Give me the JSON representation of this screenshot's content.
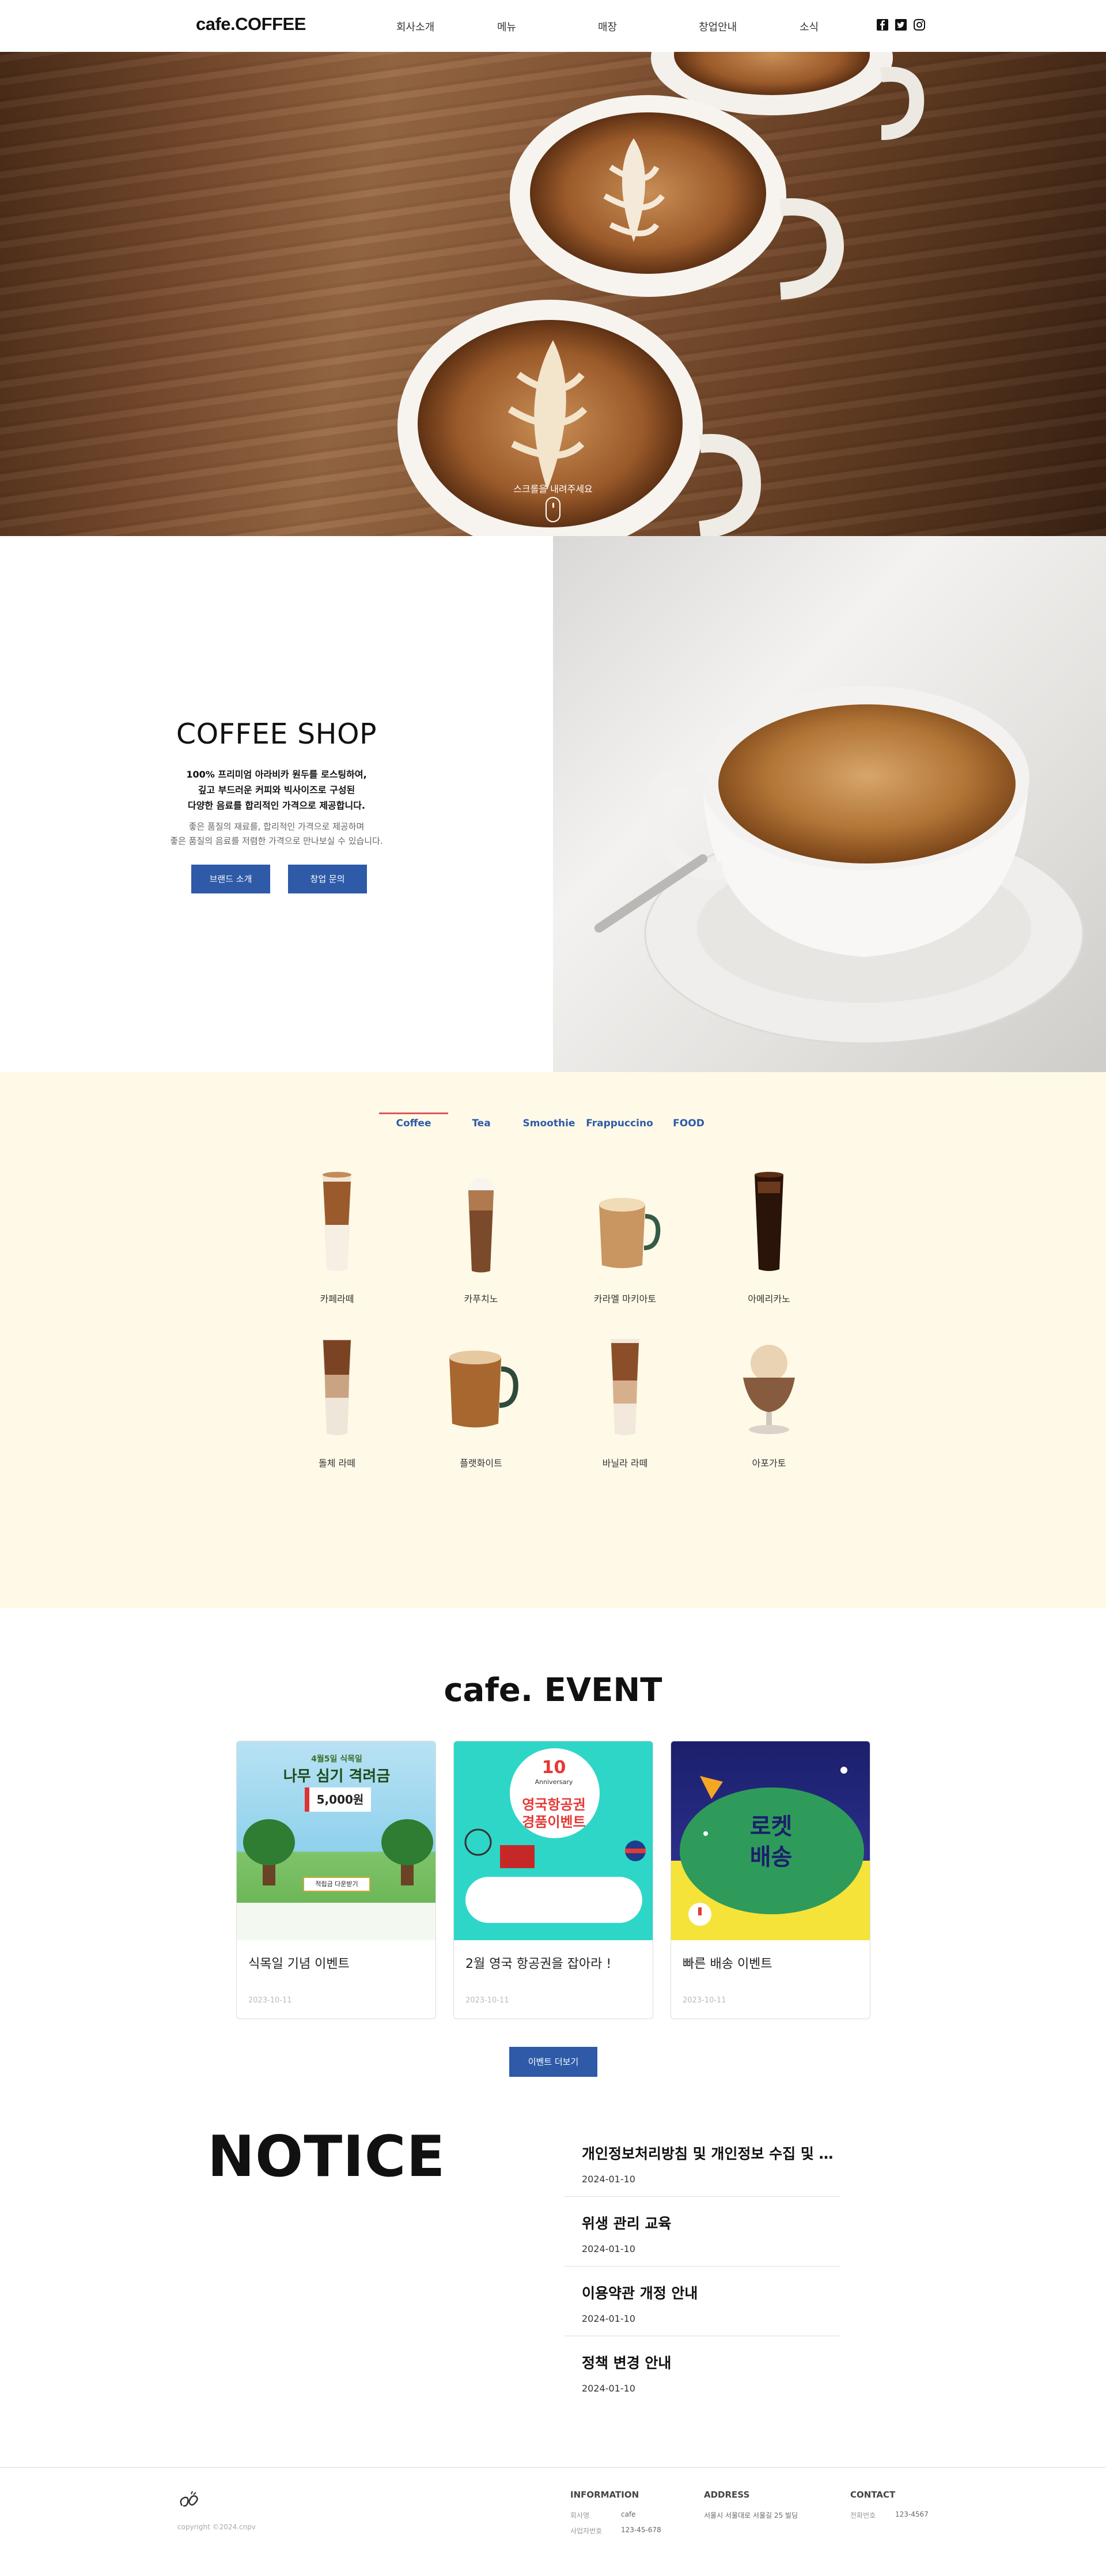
{
  "header": {
    "logo": "cafe.COFFEE",
    "nav": [
      "회사소개",
      "메뉴",
      "매장",
      "창업안내",
      "소식"
    ],
    "social_icons": [
      "facebook-icon",
      "twitter-icon",
      "instagram-icon"
    ]
  },
  "hero": {
    "scroll_hint": "스크롤을 내려주세요"
  },
  "intro": {
    "title": "COFFEE SHOP",
    "bold_lines": [
      "100% 프리미엄 아라비카 원두를 로스팅하여,",
      "깊고 부드러운 커피와 빅사이즈로 구성된",
      "다양한 음료를 합리적인 가격으로 제공합니다."
    ],
    "sub_lines": [
      "좋은 품질의 재료를, 합리적인 가격으로 제공하며",
      "좋은 품질의 음료를 저렴한 가격으로 만나보실 수 있습니다."
    ],
    "buttons": [
      "브랜드 소개",
      "창업 문의"
    ]
  },
  "menu": {
    "tabs": [
      "Coffee",
      "Tea",
      "Smoothie",
      "Frappuccino",
      "FOOD"
    ],
    "active_tab": "Coffee",
    "products": [
      "카페라떼",
      "카푸치노",
      "카라멜 마키아토",
      "아메리카노",
      "돌체 라떼",
      "플랫화이트",
      "바닐라 라떼",
      "아포가토"
    ]
  },
  "events": {
    "title": "cafe. EVENT",
    "cards": [
      {
        "title": "식목일 기념 이벤트",
        "date": "2023-10-11",
        "poster": {
          "kicker": "4월5일 식목일",
          "headline": "나무 심기 격려금",
          "amount": "5,000원",
          "cta": "적립금 다운받기"
        }
      },
      {
        "title": "2월 영국 항공권을 잡아라 !",
        "date": "2023-10-11",
        "poster": {
          "badge_number": "10",
          "badge_text": "Anniversary",
          "headline_1": "영국항공권",
          "headline_2": "경품이벤트"
        }
      },
      {
        "title": "빠른 배송 이벤트",
        "date": "2023-10-11",
        "poster": {
          "headline_1": "로켓",
          "headline_2": "배송"
        }
      }
    ],
    "more_button": "이벤트 더보기"
  },
  "notice": {
    "title": "NOTICE",
    "items": [
      {
        "title": "개인정보처리방침 및 개인정보 수집 및 이용 안내",
        "date": "2024-01-10"
      },
      {
        "title": "위생 관리 교육",
        "date": "2024-01-10"
      },
      {
        "title": "이용약관 개정 안내",
        "date": "2024-01-10"
      },
      {
        "title": "정책 변경 안내",
        "date": "2024-01-10"
      }
    ]
  },
  "footer": {
    "copyright": "copyright ©2024.cnpv",
    "information": {
      "heading": "INFORMATION",
      "rows": [
        {
          "k": "회사명",
          "v": "cafe"
        },
        {
          "k": "사업자번호",
          "v": "123-45-678"
        }
      ]
    },
    "address": {
      "heading": "ADDRESS",
      "text": "서울시 서울대로 서울길 25 빌딩"
    },
    "contact": {
      "heading": "CONTACT",
      "rows": [
        {
          "k": "전화번호",
          "v": "123-4567"
        }
      ]
    }
  },
  "colors": {
    "accent_blue": "#2e5aa8",
    "menu_bg": "#fffae8",
    "tab_indicator": "#e0555b"
  }
}
